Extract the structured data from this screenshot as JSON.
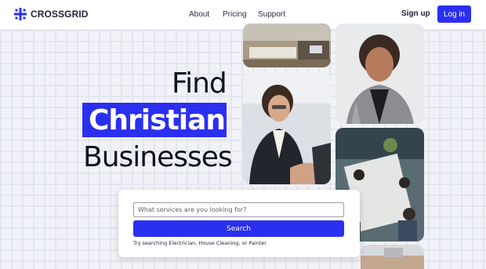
{
  "header": {
    "brand": "CROSSGRID",
    "nav": [
      {
        "label": "About"
      },
      {
        "label": "Pricing"
      },
      {
        "label": "Support"
      }
    ],
    "signup_label": "Sign up",
    "login_label": "Log in"
  },
  "hero": {
    "line1": "Find",
    "line2": "Christian",
    "line3": "Businesses"
  },
  "search": {
    "placeholder": "What services are you looking for?",
    "button_label": "Search",
    "hint": "Try searching Electrician, House Cleaning, or Painter"
  },
  "colors": {
    "accent": "#2b2ff0",
    "background": "#f1f2f7"
  }
}
